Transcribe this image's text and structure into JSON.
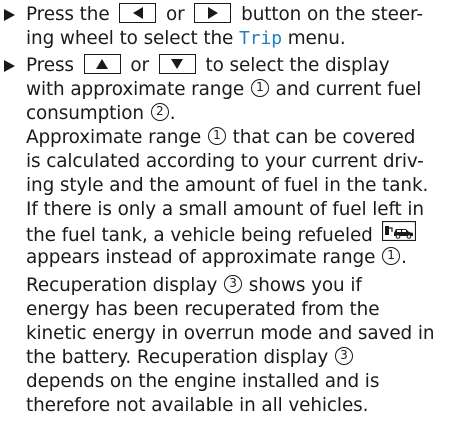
{
  "lines": {
    "l1_a": "Press the",
    "l1_b": "or",
    "l1_c": "button on the steer-",
    "l2_a": "ing wheel to select the",
    "l2_menu": "Trip",
    "l2_b": "menu.",
    "l3_a": "Press",
    "l3_b": "or",
    "l3_c": "to select the display",
    "l4_a": "with approximate range",
    "l4_n1": "1",
    "l4_b": "and current fuel",
    "l5_a": "consumption",
    "l5_n2": "2",
    "l5_b": ".",
    "l6": "Approximate range",
    "l6_n1": "1",
    "l6_b": "that can be covered",
    "l7": "is calculated according to your current driv-",
    "l8": "ing style and the amount of fuel in the tank.",
    "l9": "If there is only a small amount of fuel left in",
    "l10_a": "the fuel tank, a vehicle being refueled",
    "l11_a": "appears instead of approximate range",
    "l11_n1": "1",
    "l11_b": ".",
    "l12_a": "Recuperation display",
    "l12_n3": "3",
    "l12_b": "shows you if",
    "l13": "energy has been recuperated from the",
    "l14": "kinetic energy in overrun mode and saved in",
    "l15_a": "the battery. Recuperation display",
    "l15_n3": "3",
    "l16": "depends on the engine installed and is",
    "l17": "therefore not available in all vehicles."
  },
  "icons": {
    "bullet": "right-triangle-bullet-icon",
    "left_button": "left-arrow-button-icon",
    "right_button": "right-arrow-button-icon",
    "up_button": "up-arrow-button-icon",
    "down_button": "down-arrow-button-icon",
    "refuel": "vehicle-refueling-icon"
  },
  "colors": {
    "text": "#1a1a1a",
    "menu_highlight": "#1f7fc2"
  }
}
